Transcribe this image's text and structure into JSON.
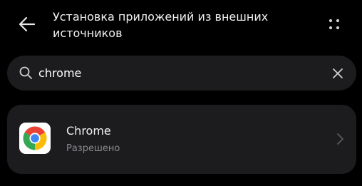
{
  "header": {
    "back_icon": "arrow-left-icon",
    "title": "Установка приложений из внешних источников",
    "more_icon": "more-vertical-icon"
  },
  "search": {
    "icon": "search-icon",
    "value": "chrome",
    "clear_icon": "close-icon"
  },
  "app_list": {
    "items": [
      {
        "icon": "chrome-logo",
        "name": "Chrome",
        "status": "Разрешено",
        "chevron_icon": "chevron-right-icon"
      }
    ]
  },
  "colors": {
    "background": "#000000",
    "surface": "#1c1c1e",
    "text_primary": "#f2f2f2",
    "text_secondary": "#8a8a8e"
  }
}
